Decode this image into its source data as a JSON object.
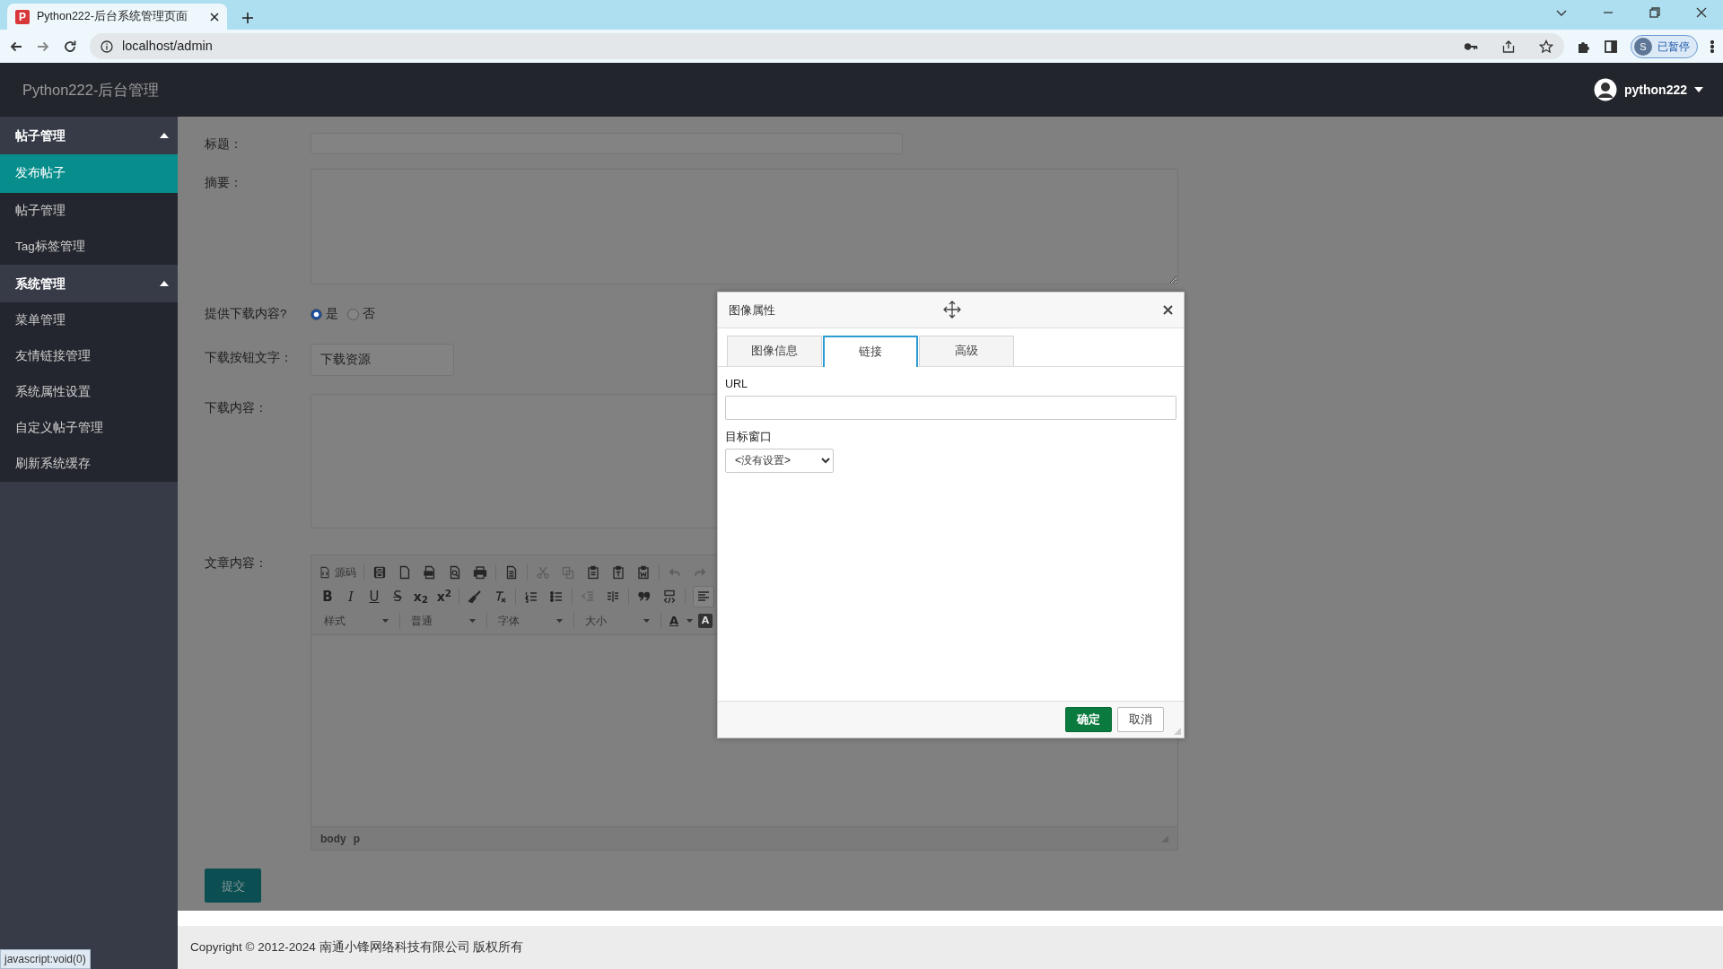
{
  "browser": {
    "tab": {
      "favicon": "P",
      "title": "Python222-后台系统管理页面"
    },
    "address": "localhost/admin",
    "profile": {
      "initial": "S",
      "status": "已暂停"
    }
  },
  "navbar": {
    "brand": "Python222-后台管理",
    "user": "python222"
  },
  "sidebar": {
    "groups": [
      {
        "title": "帖子管理",
        "expanded": true,
        "items": [
          {
            "label": "发布帖子",
            "selected": true
          },
          {
            "label": "帖子管理",
            "selected": false
          },
          {
            "label": "Tag标签管理",
            "selected": false
          }
        ]
      },
      {
        "title": "系统管理",
        "expanded": true,
        "items": [
          {
            "label": "菜单管理",
            "selected": false
          },
          {
            "label": "友情链接管理",
            "selected": false
          },
          {
            "label": "系统属性设置",
            "selected": false
          },
          {
            "label": "自定义帖子管理",
            "selected": false
          },
          {
            "label": "刷新系统缓存",
            "selected": false
          }
        ]
      }
    ]
  },
  "form": {
    "fields": [
      {
        "kind": "input",
        "label": "标题："
      },
      {
        "kind": "textarea",
        "label": "摘要："
      },
      {
        "kind": "radio",
        "label": "提供下载内容?",
        "options": [
          {
            "label": "是",
            "checked": true
          },
          {
            "label": "否",
            "checked": false
          }
        ]
      },
      {
        "kind": "short-input",
        "label": "下载按钮文字：",
        "value": "下载资源"
      },
      {
        "kind": "textarea",
        "label": "下载内容："
      },
      {
        "kind": "editor",
        "label": "文章内容：",
        "path": [
          "body",
          "p"
        ],
        "toolbar": [
          [
            {
              "kind": "source",
              "label": "源码"
            },
            {
              "kind": "sep"
            },
            {
              "kind": "icon",
              "disabled": false
            },
            {
              "kind": "icon",
              "disabled": false
            },
            {
              "kind": "icon",
              "disabled": false
            },
            {
              "kind": "icon",
              "disabled": false
            },
            {
              "kind": "icon",
              "disabled": false
            },
            {
              "kind": "sep"
            },
            {
              "kind": "icon",
              "disabled": false
            },
            {
              "kind": "sep"
            },
            {
              "kind": "icon",
              "disabled": true
            },
            {
              "kind": "icon",
              "disabled": true
            },
            {
              "kind": "icon",
              "disabled": false
            },
            {
              "kind": "icon",
              "disabled": false
            },
            {
              "kind": "icon",
              "disabled": false
            },
            {
              "kind": "sep"
            },
            {
              "kind": "icon",
              "disabled": true
            },
            {
              "kind": "icon",
              "disabled": true
            }
          ],
          [
            {
              "kind": "bold",
              "text": "B"
            },
            {
              "kind": "italic",
              "text": "I"
            },
            {
              "kind": "underline",
              "text": "U"
            },
            {
              "kind": "strike",
              "text": "S"
            },
            {
              "kind": "subscript",
              "text": "x$_{2}$"
            },
            {
              "kind": "superscript",
              "text": "x$^{2}$"
            },
            {
              "kind": "sep"
            },
            {
              "kind": "icon",
              "disabled": false
            },
            {
              "kind": "icon",
              "disabled": false
            },
            {
              "kind": "sep"
            },
            {
              "kind": "icon",
              "disabled": false
            },
            {
              "kind": "icon",
              "disabled": false
            },
            {
              "kind": "sep"
            },
            {
              "kind": "icon",
              "disabled": true
            },
            {
              "kind": "icon",
              "disabled": false
            },
            {
              "kind": "sep"
            },
            {
              "kind": "icon",
              "disabled": false
            },
            {
              "kind": "icon",
              "disabled": false
            },
            {
              "kind": "sep"
            },
            {
              "kind": "icon",
              "disabled": false
            }
          ],
          [
            {
              "kind": "combo",
              "label": "样式"
            },
            {
              "kind": "sep"
            },
            {
              "kind": "combo",
              "label": "普通"
            },
            {
              "kind": "sep"
            },
            {
              "kind": "combo",
              "label": "字体"
            },
            {
              "kind": "sep"
            },
            {
              "kind": "combo",
              "label": "大小"
            },
            {
              "kind": "sep"
            },
            {
              "kind": "textcolor",
              "text": "A"
            },
            {
              "kind": "bgcolor",
              "text": "A"
            }
          ]
        ]
      }
    ],
    "submit": "提交"
  },
  "dialog": {
    "title": "图像属性",
    "tabs": [
      {
        "label": "图像信息",
        "selected": false
      },
      {
        "label": "链接",
        "selected": true
      },
      {
        "label": "高级",
        "selected": false
      }
    ],
    "url_label": "URL",
    "target_label": "目标窗口",
    "target_value": "<没有设置>",
    "buttons": [
      {
        "kind": "primary",
        "label": "确定"
      },
      {
        "kind": "secondary",
        "label": "取消"
      }
    ]
  },
  "footer": "Copyright © 2012-2024 南通小锋网络科技有限公司 版权所有",
  "status_link": "javascript:void(0)"
}
